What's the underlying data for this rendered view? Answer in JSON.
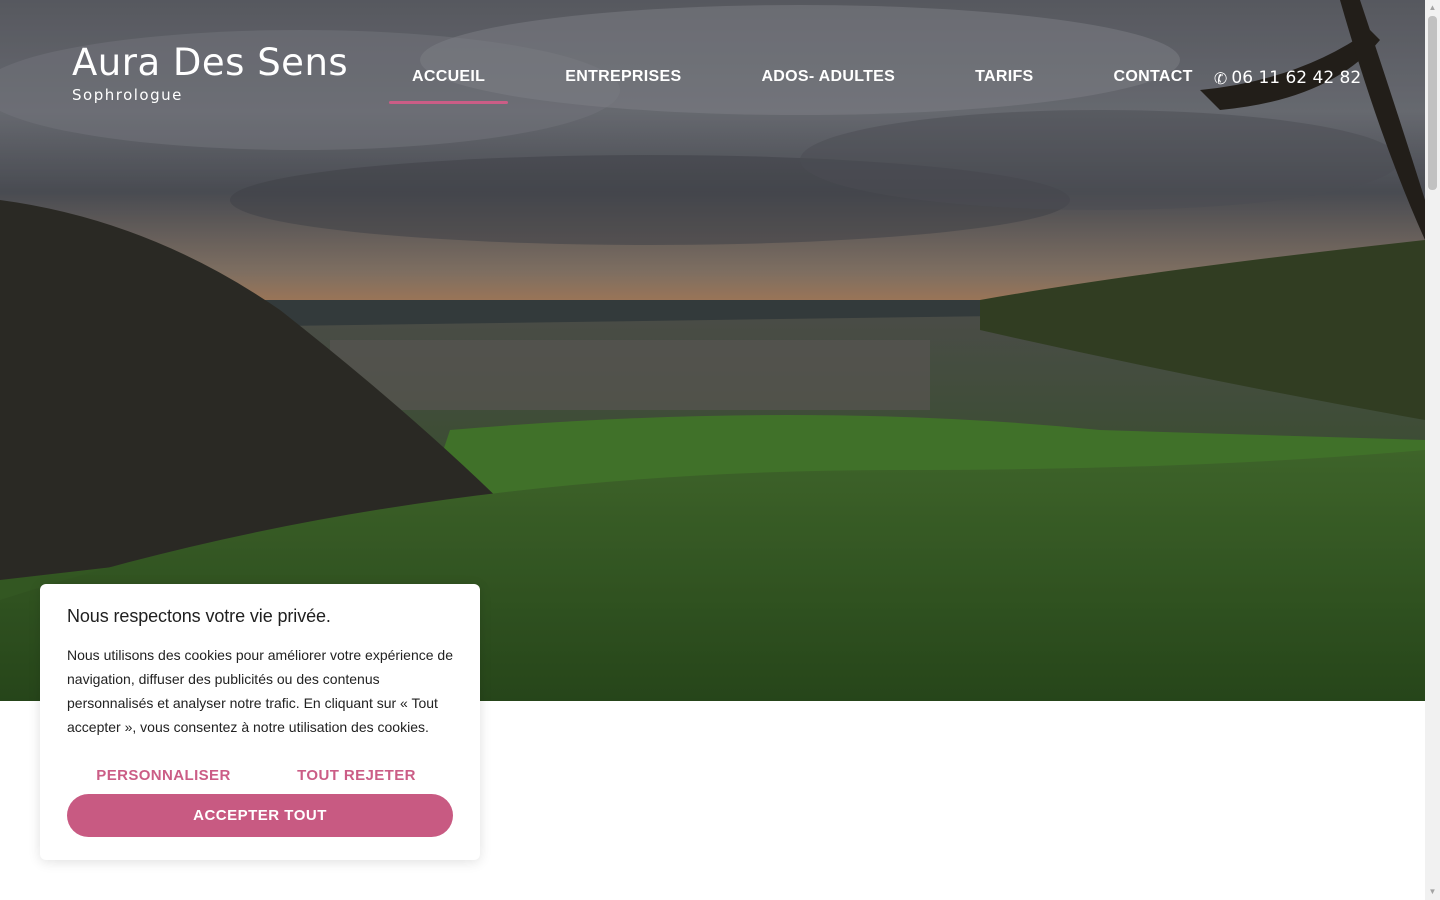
{
  "brand": {
    "title": "Aura Des Sens",
    "subtitle": "Sophrologue"
  },
  "nav": {
    "items": [
      {
        "label": "ACCUEIL",
        "active": true
      },
      {
        "label": "ENTREPRISES"
      },
      {
        "label": "ADOS- ADULTES"
      },
      {
        "label": "TARIFS"
      },
      {
        "label": "CONTACT"
      }
    ],
    "phone": "06 11 62 42 82",
    "phone_icon": "phone-icon",
    "active_color": "#cb5d86"
  },
  "cookie": {
    "title": "Nous respectons votre vie privée.",
    "text": "Nous utilisons des cookies pour améliorer votre expérience de navigation, diffuser des publicités ou des contenus personnalisés et analyser notre trafic. En cliquant sur « Tout accepter », vous consentez à notre utilisation des cookies.",
    "customize_label": "PERSONNALISER",
    "reject_label": "TOUT REJETER",
    "accept_label": "ACCEPTER TOUT",
    "accent": "#c85a82"
  }
}
